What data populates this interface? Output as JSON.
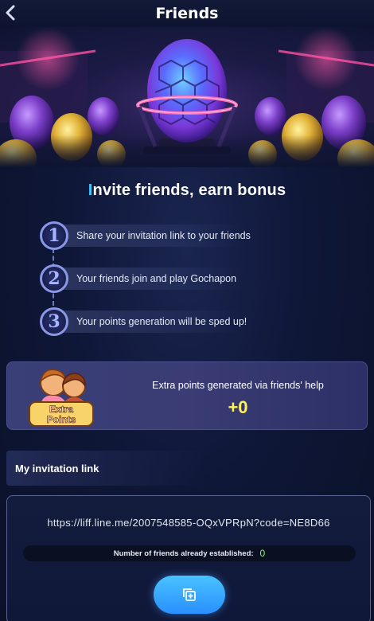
{
  "header": {
    "title": "Friends",
    "back_icon": "chevron-left-icon"
  },
  "hero": {
    "image": "gochapon-egg-illustration"
  },
  "heading": {
    "first_letter": "I",
    "rest": "nvite friends, earn bonus"
  },
  "steps": [
    {
      "number": "1",
      "text": "Share your invitation link to your friends"
    },
    {
      "number": "2",
      "text": "Your friends join and play Gochapon"
    },
    {
      "number": "3",
      "text": "Your points generation will be sped up!"
    }
  ],
  "extra_points": {
    "badge_line1": "Extra",
    "badge_line2": "Points",
    "label": "Extra points generated via friends' help",
    "value": "+0"
  },
  "invitation": {
    "section_title": "My invitation link",
    "url": "https://liff.line.me/2007548585-OQxVPRpN?code=NE8D66",
    "friends_label": "Number of friends already established:",
    "friends_count": "0",
    "copy_icon": "copy-icon"
  },
  "colors": {
    "accent_cyan": "#3fc6ff",
    "value_yellow": "#fff35a",
    "count_green": "#7dff6e",
    "button_blue": "#2a8fff"
  }
}
